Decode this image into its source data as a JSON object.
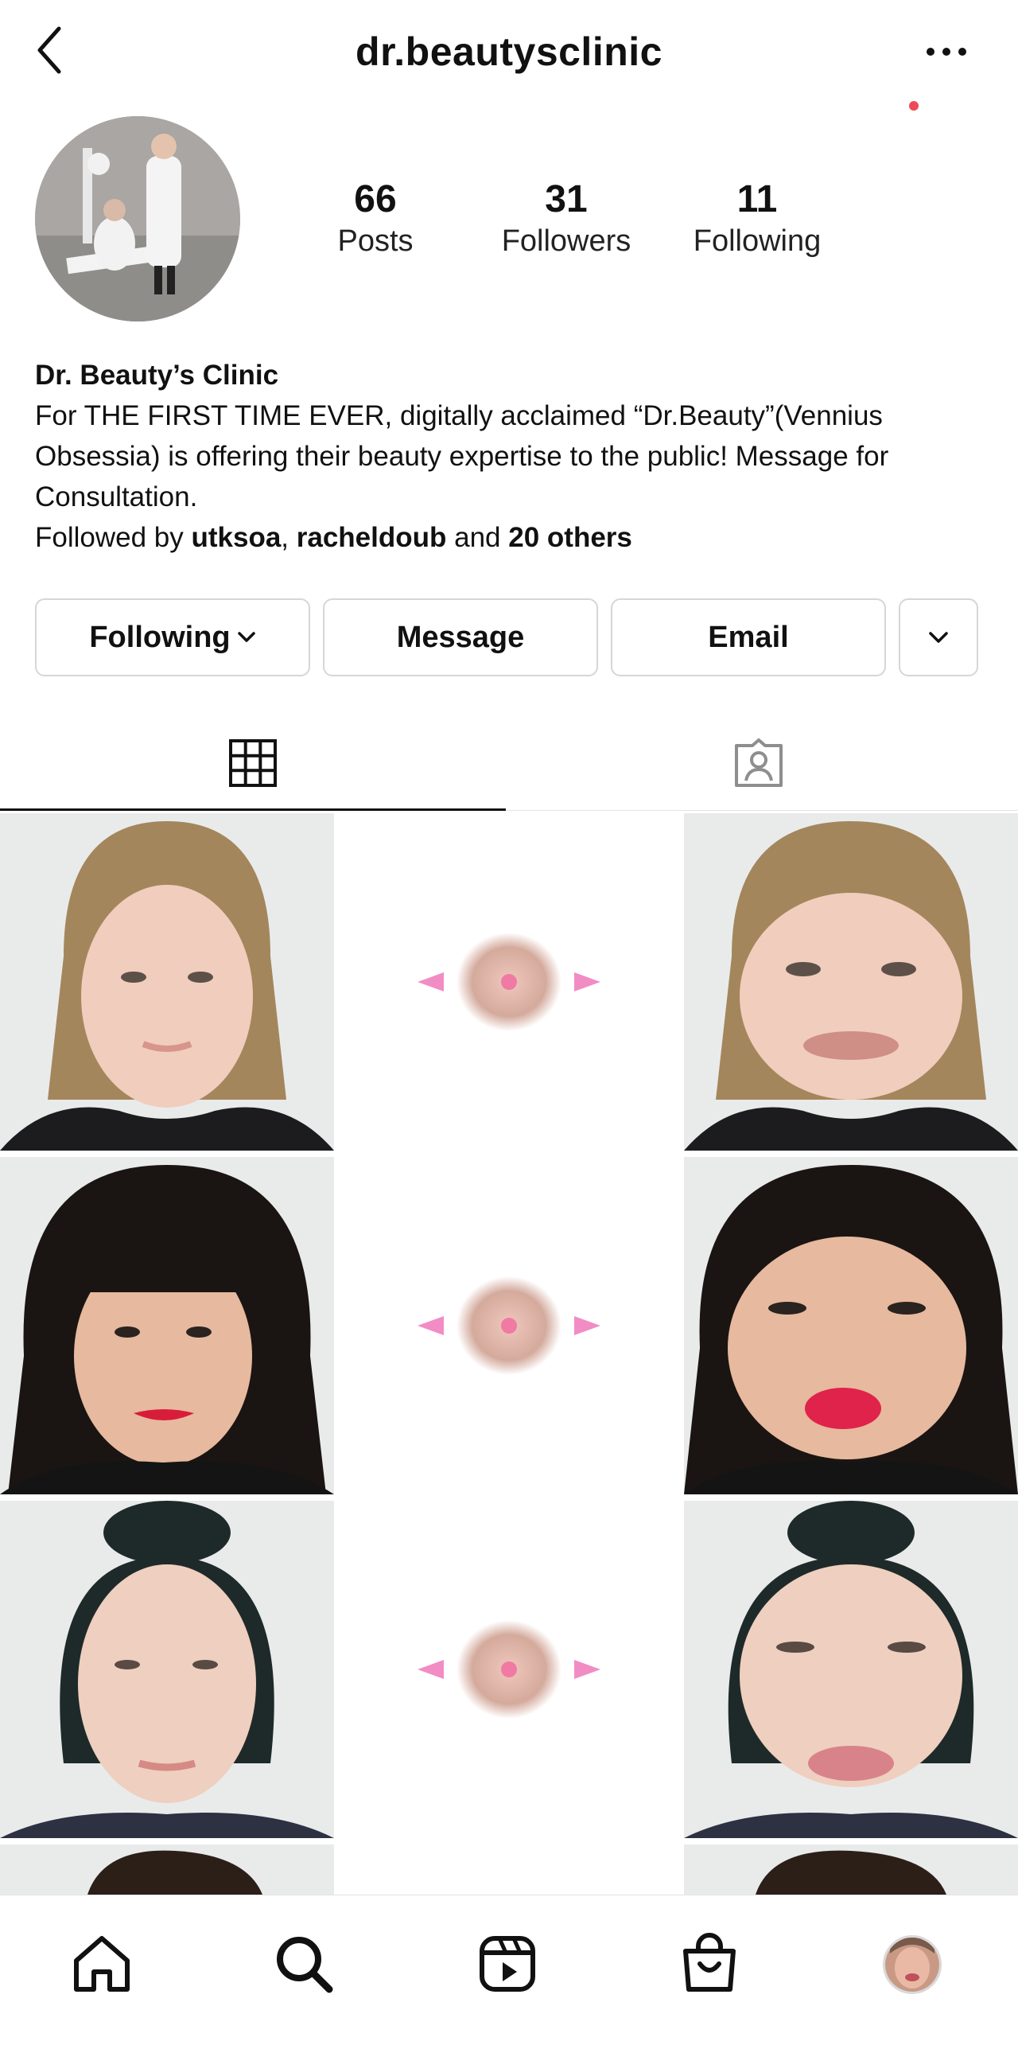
{
  "header": {
    "username": "dr.beautysclinic",
    "back_icon": "chevron-left-icon",
    "more_icon": "ellipsis-icon"
  },
  "profile": {
    "stats": [
      {
        "value": "66",
        "label": "Posts"
      },
      {
        "value": "31",
        "label": "Followers"
      },
      {
        "value": "11",
        "label": "Following"
      }
    ],
    "display_name": "Dr. Beauty’s Clinic",
    "bio_line1": "For THE FIRST TIME EVER, digitally acclaimed “Dr.Beauty”(Vennius",
    "bio_line2": "Obsessia) is offering their beauty expertise to the public! Message for",
    "bio_line3": "Consultation.",
    "followed_by_prefix": "Followed by ",
    "followed_by_user1": "utksoa",
    "followed_by_sep": ", ",
    "followed_by_user2": "racheldoub",
    "followed_by_and": " and ",
    "followed_by_others": "20 others"
  },
  "actions": {
    "following_label": "Following",
    "message_label": "Message",
    "email_label": "Email"
  },
  "tabs": [
    {
      "icon": "grid-icon",
      "active": true
    },
    {
      "icon": "tagged-icon",
      "active": false
    }
  ],
  "colors": {
    "text": "#111111",
    "border": "#d6d6d6",
    "notification": "#ed4956",
    "arrow_pink": "#f28cc4"
  },
  "bottom_nav": [
    {
      "icon": "home-icon"
    },
    {
      "icon": "search-icon"
    },
    {
      "icon": "reels-icon"
    },
    {
      "icon": "shop-icon"
    },
    {
      "icon": "profile-avatar"
    }
  ]
}
